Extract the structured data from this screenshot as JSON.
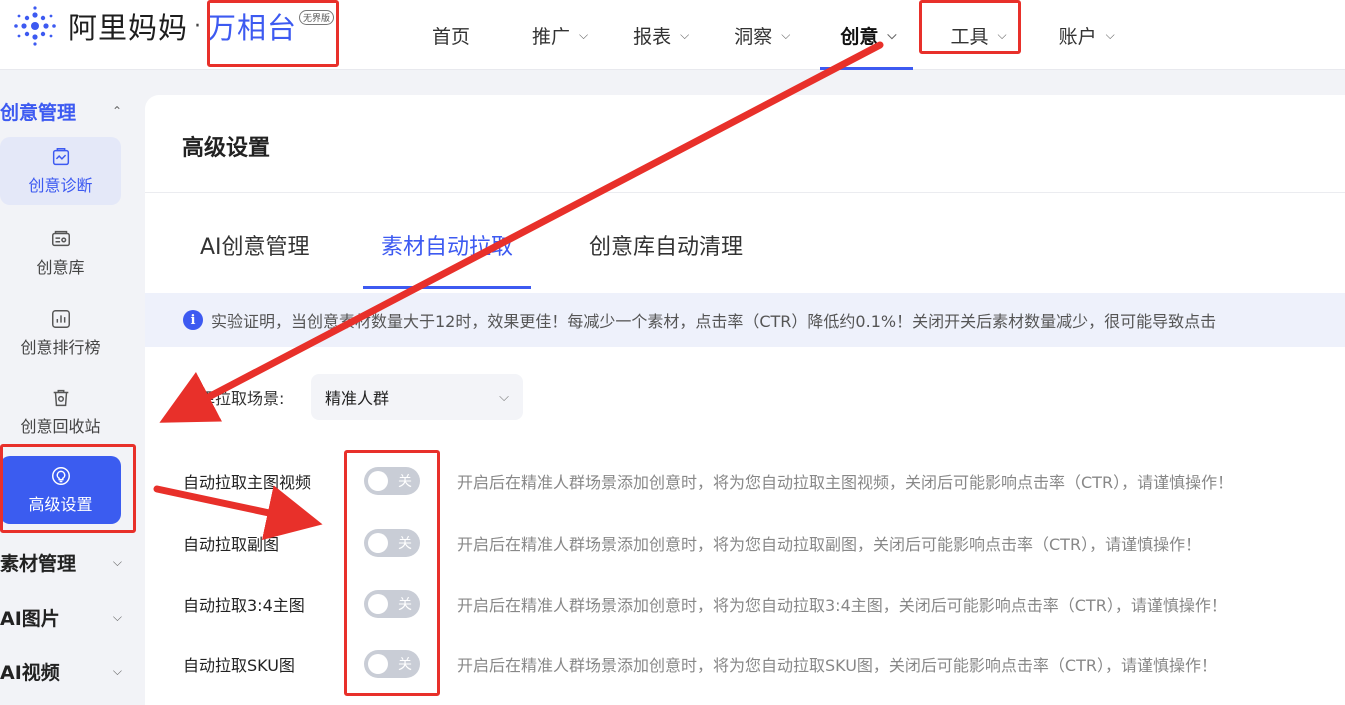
{
  "header": {
    "logo_text": "阿里妈妈",
    "logo_dot": "·",
    "brand": "万相台",
    "edition": "无界版",
    "nav": [
      {
        "label": "首页",
        "has_menu": false,
        "active": false
      },
      {
        "label": "推广",
        "has_menu": true,
        "active": false
      },
      {
        "label": "报表",
        "has_menu": true,
        "active": false
      },
      {
        "label": "洞察",
        "has_menu": true,
        "active": false
      },
      {
        "label": "创意",
        "has_menu": true,
        "active": true
      },
      {
        "label": "工具",
        "has_menu": true,
        "active": false
      },
      {
        "label": "账户",
        "has_menu": true,
        "active": false
      }
    ],
    "chevron": "⌵"
  },
  "sidebar": {
    "groups": [
      {
        "label": "创意管理",
        "expanded": true
      },
      {
        "label": "素材管理",
        "expanded": false
      },
      {
        "label": "AI图片",
        "expanded": false
      },
      {
        "label": "AI视频",
        "expanded": false
      }
    ],
    "items": [
      {
        "label": "创意诊断",
        "icon": "diagnosis-icon"
      },
      {
        "label": "创意库",
        "icon": "library-icon"
      },
      {
        "label": "创意排行榜",
        "icon": "ranking-icon"
      },
      {
        "label": "创意回收站",
        "icon": "recycle-bin-icon"
      },
      {
        "label": "高级设置",
        "icon": "advanced-settings-icon"
      }
    ],
    "selected_item": "高级设置"
  },
  "main": {
    "title": "高级设置",
    "tabs": [
      {
        "label": "AI创意管理",
        "active": false
      },
      {
        "label": "素材自动拉取",
        "active": true
      },
      {
        "label": "创意库自动清理",
        "active": false
      }
    ],
    "notice": {
      "icon": "info-icon",
      "icon_glyph": "i",
      "text": "实验证明，当创意素材数量大于12时，效果更佳！每减少一个素材，点击率（CTR）降低约0.1%！关闭开关后素材数量减少，很可能导致点击"
    },
    "scene_label": "选择拉取场景:",
    "scene_select": {
      "value": "精准人群",
      "chevron": "⌵"
    },
    "rows": [
      {
        "label": "自动拉取主图视频",
        "toggle_text": "关",
        "on": false,
        "desc": "开启后在精准人群场景添加创意时，将为您自动拉取主图视频，关闭后可能影响点击率（CTR），请谨慎操作！"
      },
      {
        "label": "自动拉取副图",
        "toggle_text": "关",
        "on": false,
        "desc": "开启后在精准人群场景添加创意时，将为您自动拉取副图，关闭后可能影响点击率（CTR），请谨慎操作！"
      },
      {
        "label": "自动拉取3:4主图",
        "toggle_text": "关",
        "on": false,
        "desc": "开启后在精准人群场景添加创意时，将为您自动拉取3:4主图，关闭后可能影响点击率（CTR），请谨慎操作！"
      },
      {
        "label": "自动拉取SKU图",
        "toggle_text": "关",
        "on": false,
        "desc": "开启后在精准人群场景添加创意时，将为您自动拉取SKU图，关闭后可能影响点击率（CTR），请谨慎操作！"
      }
    ]
  },
  "colors": {
    "accent": "#3d5af1",
    "annotation": "#e8302a",
    "toggle_off": "#c9cdd6"
  }
}
